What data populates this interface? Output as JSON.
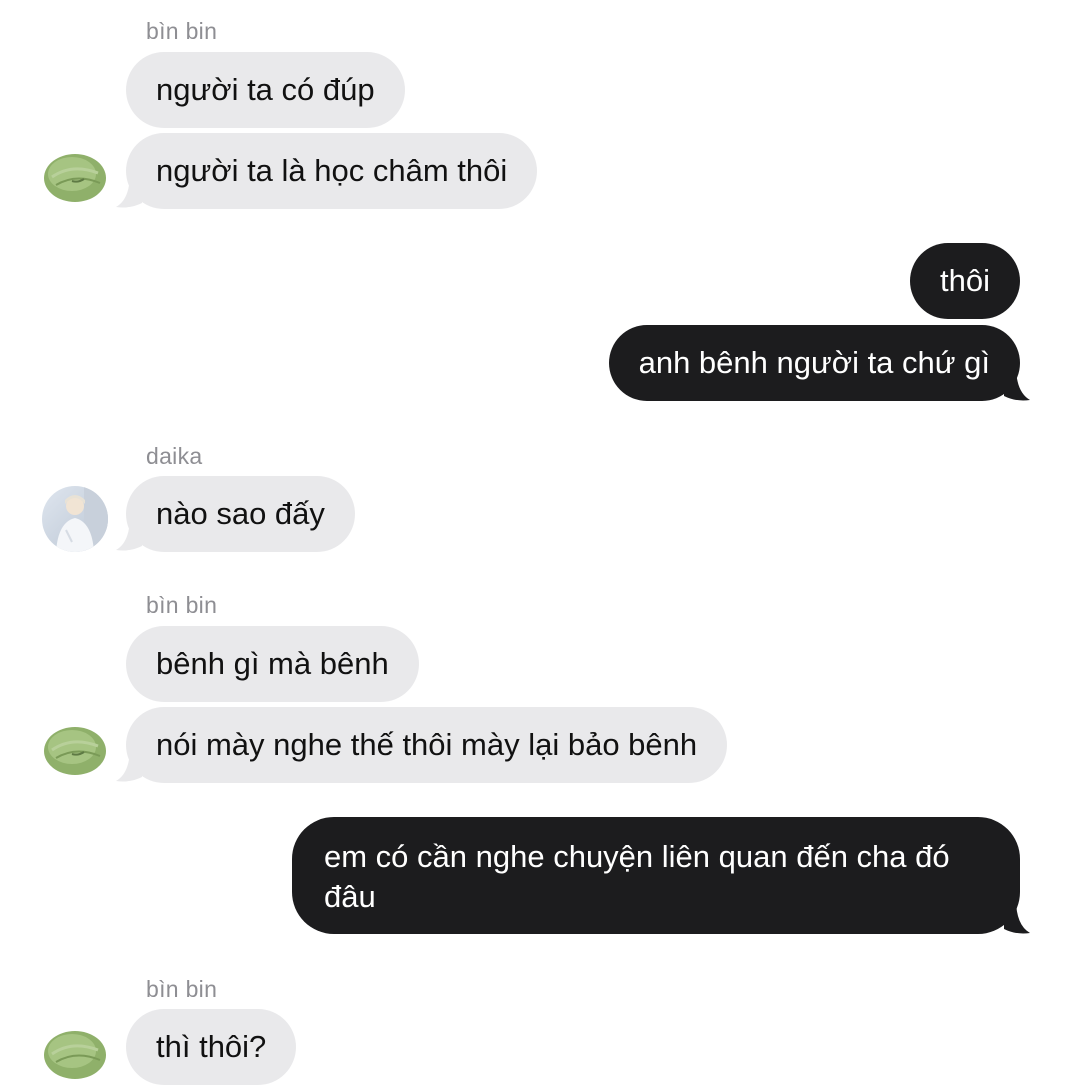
{
  "colors": {
    "incoming_bubble": "#e9e9eb",
    "outgoing_bubble": "#1c1c1e",
    "incoming_text": "#111111",
    "outgoing_text": "#ffffff",
    "sender_name": "#8e8e93"
  },
  "messages": {
    "group1": {
      "sender": "bìn bin",
      "avatar": "cabbage-avatar-icon",
      "m1": "người ta có đúp",
      "m2": "người ta là học châm thôi"
    },
    "group2": {
      "m1": "thôi",
      "m2": "anh bênh người ta chứ gì"
    },
    "group3": {
      "sender": "daika",
      "avatar": "person-photo-avatar",
      "m1": "nào sao đấy"
    },
    "group4": {
      "sender": "bìn bin",
      "avatar": "cabbage-avatar-icon",
      "m1": "bênh gì mà bênh",
      "m2": "nói mày nghe thế thôi mày lại bảo bênh"
    },
    "group5": {
      "m1": "em có cần nghe chuyện liên quan đến cha đó đâu"
    },
    "group6": {
      "sender": "bìn bin",
      "avatar": "cabbage-avatar-icon",
      "m1": "thì thôi?"
    }
  }
}
